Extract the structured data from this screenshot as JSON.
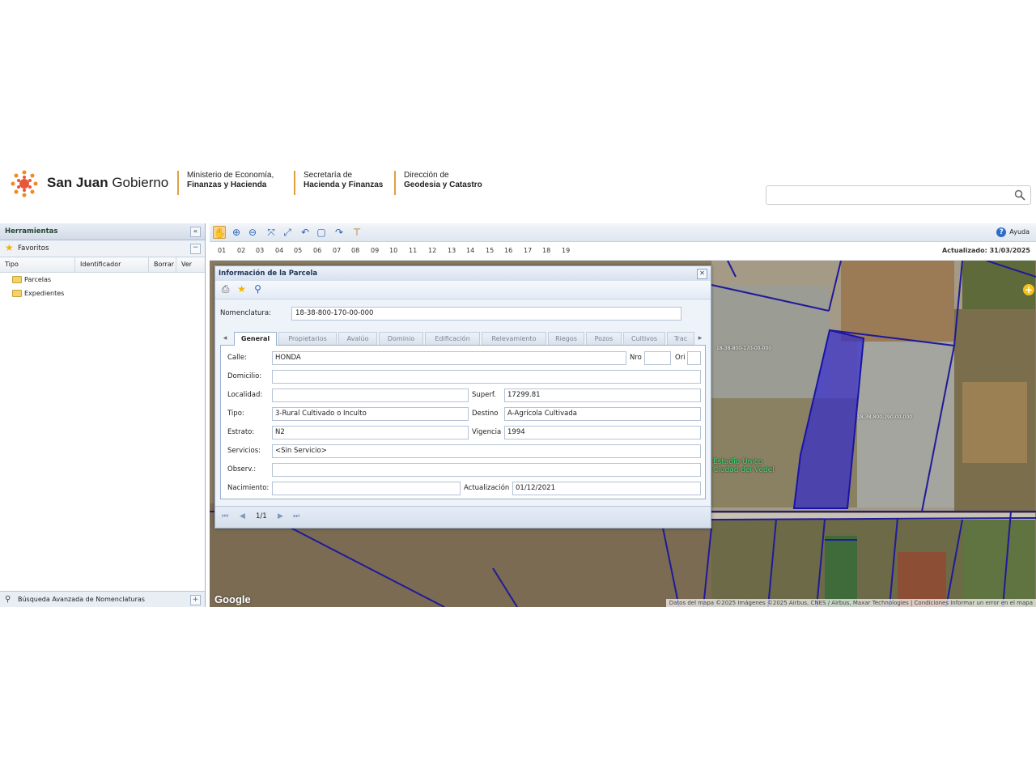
{
  "header": {
    "brand_bold": "San Juan",
    "brand_light": "Gobierno",
    "org1_line1": "Ministerio de Economía,",
    "org1_line2": "Finanzas y Hacienda",
    "org2_line1": "Secretaría de",
    "org2_line2": "Hacienda y Finanzas",
    "org3_line1": "Dirección de",
    "org3_line2": "Geodesia y Catastro",
    "search_value": ""
  },
  "left_panel": {
    "title": "Herramientas",
    "favorites": "Favoritos",
    "columns": [
      "Tipo",
      "Identificador",
      "Borrar",
      "Ver"
    ],
    "tree": [
      "Parcelas",
      "Expedientes"
    ],
    "bottom": "Búsqueda Avanzada de Nomenclaturas"
  },
  "toolbar": {
    "help": "Ayuda"
  },
  "levels": [
    "01",
    "02",
    "03",
    "04",
    "05",
    "06",
    "07",
    "08",
    "09",
    "10",
    "11",
    "12",
    "13",
    "14",
    "15",
    "16",
    "17",
    "18",
    "19"
  ],
  "updated": "Actualizado: 31/03/2025",
  "map": {
    "google": "Google",
    "attribution": "Datos del mapa ©2025 Imágenes ©2025 Airbus, CNES / Airbus, Maxar Technologies  |  Condiciones  Informar un error en el mapa",
    "label_green": "Estadio Único\nCiudad del Vedel",
    "label_small1": "18-38-800-170-00-000",
    "label_small2": "18-38-800-190-00-000"
  },
  "parcel_window": {
    "title": "Información de la Parcela",
    "nomenclatura_label": "Nomenclatura:",
    "nomenclatura_value": "18-38-800-170-00-000",
    "tabs": [
      "General",
      "Propietarios",
      "Avalúo",
      "Dominio",
      "Edificación",
      "Relevamiento",
      "Riegos",
      "Pozos",
      "Cultivos",
      "Trac"
    ],
    "fields": {
      "calle_label": "Calle:",
      "calle_value": "HONDA",
      "nro_label": "Nro",
      "ori_label": "Ori",
      "domicilio_label": "Domicilio:",
      "localidad_label": "Localidad:",
      "superf_label": "Superf.",
      "superf_value": "17299.81",
      "tipo_label": "Tipo:",
      "tipo_value": "3-Rural Cultivado o Inculto",
      "destino_label": "Destino",
      "destino_value": "A-Agrícola Cultivada",
      "estrato_label": "Estrato:",
      "estrato_value": "N2",
      "vigencia_label": "Vigencia",
      "vigencia_value": "1994",
      "servicios_label": "Servicios:",
      "servicios_value": "<Sin Servicio>",
      "observ_label": "Observ.:",
      "nacimiento_label": "Nacimiento:",
      "actualizacion_label": "Actualización",
      "actualizacion_value": "01/12/2021"
    },
    "pager": "1/1"
  }
}
